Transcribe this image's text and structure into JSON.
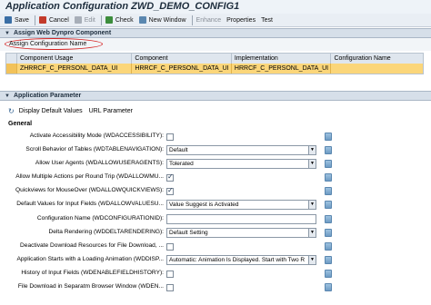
{
  "title": "Application Configuration ZWD_DEMO_CONFIG1",
  "toolbar": {
    "items": [
      {
        "label": "Save",
        "icon": "save-icon",
        "color": "#3a6ea5",
        "disabled": false
      },
      {
        "label": "Cancel",
        "icon": "cancel-icon",
        "color": "#c33a2a",
        "disabled": false
      },
      {
        "label": "Edit",
        "icon": "edit-icon",
        "color": "#a7aeb8",
        "disabled": true
      },
      {
        "label": "Check",
        "icon": "check-icon",
        "color": "#3c8d3c",
        "disabled": false
      },
      {
        "label": "New Window",
        "icon": "new-window-icon",
        "color": "#5a87b0",
        "disabled": false
      },
      {
        "label": "Enhance",
        "icon": "",
        "color": "",
        "disabled": true
      },
      {
        "label": "Properties",
        "icon": "",
        "color": "",
        "disabled": false
      },
      {
        "label": "Test",
        "icon": "",
        "color": "",
        "disabled": false
      }
    ]
  },
  "assign_panel": {
    "title": "Assign Web Dynpro Component",
    "tab_label": "Assign Configuration Name",
    "columns": [
      "Component Usage",
      "Component",
      "Implementation",
      "Configuration Name"
    ],
    "rows": [
      [
        "ZHRRCF_C_PERSONL_DATA_UI",
        "HRRCF_C_PERSONL_DATA_UI",
        "HRRCF_C_PERSONL_DATA_UI",
        ""
      ]
    ]
  },
  "param_panel": {
    "title": "Application Parameter",
    "display_defaults": "Display Default Values",
    "url_parameter": "URL Parameter",
    "section": "General",
    "params": [
      {
        "label": "Activate Accessibility Mode (WDACCESSIBILITY):",
        "type": "checkbox",
        "checked": false
      },
      {
        "label": "Scroll Behavior of Tables (WDTABLENAVIGATION):",
        "type": "select",
        "value": "Default"
      },
      {
        "label": "Allow User Agents (WDALLOWUSERAGENTS):",
        "type": "select",
        "value": "Tolerated"
      },
      {
        "label": "Allow Multiple Actions per Round Trip (WDALLOWMU...",
        "type": "checkbox",
        "checked": true
      },
      {
        "label": "Quickviews for MouseOver (WDALLOWQUICKVIEWS):",
        "type": "checkbox",
        "checked": true
      },
      {
        "label": "Default Values for Input Fields (WDALLOWVALUESU...",
        "type": "select",
        "value": "Value Suggest is Activated"
      },
      {
        "label": "Configuration Name (WDCONFIGURATIONID):",
        "type": "input",
        "value": ""
      },
      {
        "label": "Delta Rendering (WDDELTARENDERING):",
        "type": "select",
        "value": "Default Setting"
      },
      {
        "label": "Deactivate Download Resources for File Download, ...",
        "type": "checkbox",
        "checked": false
      },
      {
        "label": "Application Starts with a Loading Animation (WDDISP...",
        "type": "select",
        "value": "Automatic: Animation Is Displayed. Start with Two R"
      },
      {
        "label": "History of Input Fields (WDENABLEFIELDHISTORY):",
        "type": "checkbox",
        "checked": false
      },
      {
        "label": "File Download in Separatm Browser Window (WDEN...",
        "type": "checkbox",
        "checked": false
      }
    ]
  }
}
